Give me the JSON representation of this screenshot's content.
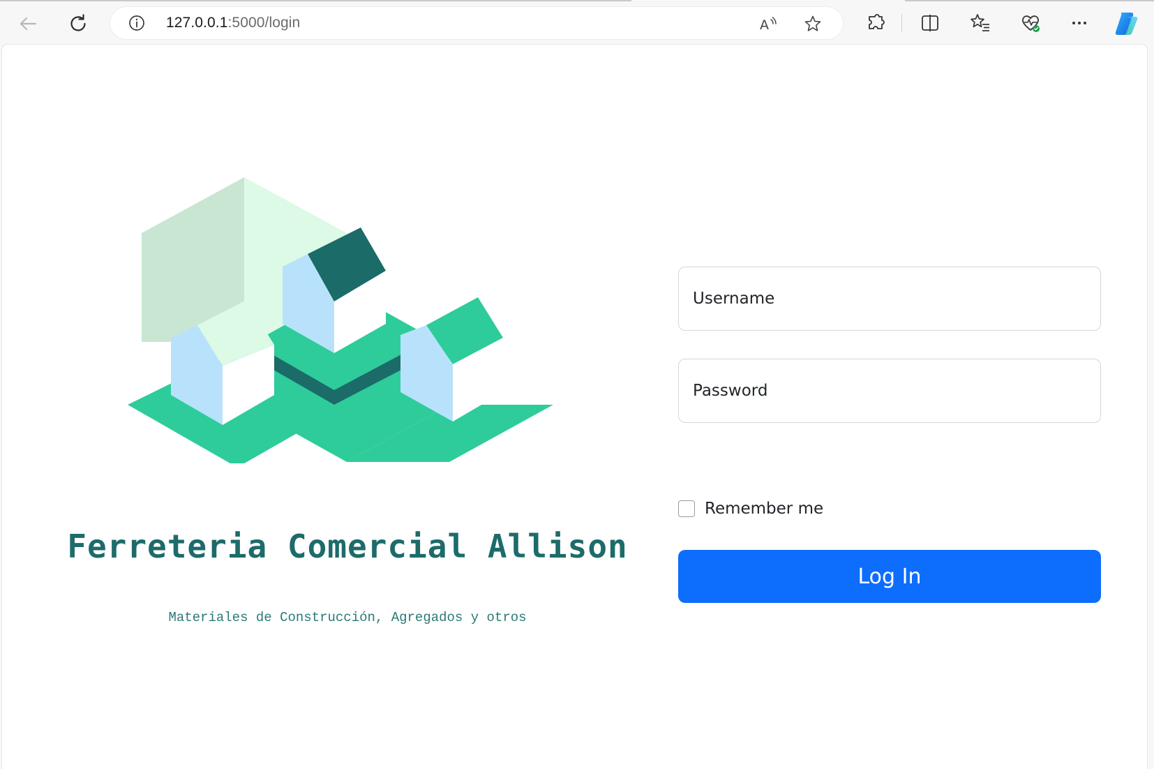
{
  "browser": {
    "url_host": "127.0.0.1",
    "url_path": ":5000/login",
    "icons": {
      "back": "back-arrow-icon",
      "refresh": "refresh-icon",
      "info": "info-icon",
      "read_aloud": "read-aloud-icon",
      "favorite": "star-icon",
      "extensions": "puzzle-icon",
      "split_screen": "split-screen-icon",
      "favorites": "favorites-icon",
      "health": "browser-essentials-icon",
      "more": "more-icon",
      "copilot": "copilot-icon"
    }
  },
  "brand": {
    "title": "Ferreteria Comercial Allison",
    "tagline": "Materiales de Construcción, Agregados y otros",
    "colors": {
      "teal_dark": "#1d6b6a",
      "green": "#2ecc9a",
      "mint": "#dcfae6",
      "pale_green": "#c8e6d2",
      "light_blue": "#b8e2fb"
    }
  },
  "login": {
    "username_placeholder": "Username",
    "password_placeholder": "Password",
    "remember_label": "Remember me",
    "remember_checked": false,
    "submit_label": "Log In",
    "accent": "#0d6efd"
  }
}
